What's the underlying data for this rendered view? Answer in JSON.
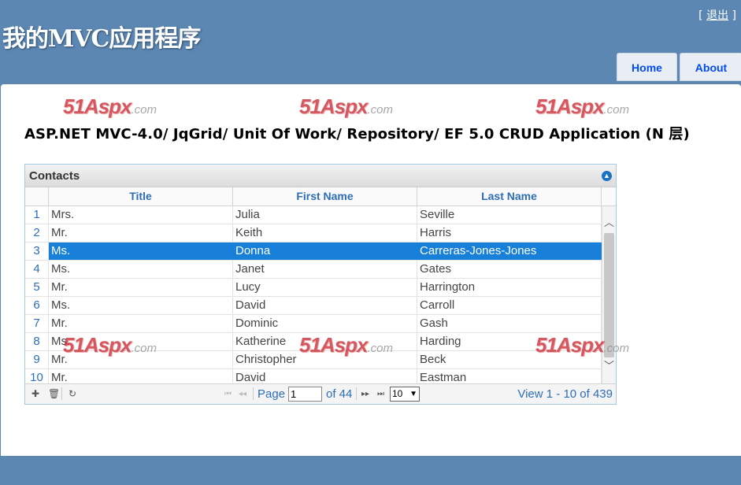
{
  "header": {
    "site_title": "我的MVC应用程序",
    "login_open": "[ ",
    "login_link": "退出",
    "login_close": " ]"
  },
  "menu": [
    {
      "label": "Home"
    },
    {
      "label": "About"
    }
  ],
  "watermark": {
    "brand": "51Aspx",
    "domain": ".com"
  },
  "page_heading": "ASP.NET MVC-4.0/ JqGrid/ Unit Of Work/ Repository/ EF 5.0 CRUD Application (N 层)",
  "grid": {
    "caption": "Contacts",
    "columns": [
      "Title",
      "First Name",
      "Last Name"
    ],
    "rows": [
      {
        "n": "1",
        "title": "Mrs.",
        "first": "Julia",
        "last": "Seville"
      },
      {
        "n": "2",
        "title": "Mr.",
        "first": "Keith",
        "last": "Harris"
      },
      {
        "n": "3",
        "title": "Ms.",
        "first": "Donna",
        "last": "Carreras-Jones-Jones"
      },
      {
        "n": "4",
        "title": "Ms.",
        "first": "Janet",
        "last": "Gates"
      },
      {
        "n": "5",
        "title": "Mr.",
        "first": "Lucy",
        "last": "Harrington"
      },
      {
        "n": "6",
        "title": "Ms.",
        "first": "David",
        "last": "Carroll"
      },
      {
        "n": "7",
        "title": "Mr.",
        "first": "Dominic",
        "last": "Gash"
      },
      {
        "n": "8",
        "title": "Ms.",
        "first": "Katherine",
        "last": "Harding"
      },
      {
        "n": "9",
        "title": "Mr.",
        "first": "Christopher",
        "last": "Beck"
      },
      {
        "n": "10",
        "title": "Mr.",
        "first": "David",
        "last": "Eastman"
      }
    ],
    "selected_row": "3",
    "pager": {
      "page_label": "Page",
      "page_value": "1",
      "of_label": "of 44",
      "rows_per_page": "10",
      "view_text": "View 1 - 10 of 439"
    }
  },
  "colors": {
    "background": "#5c87b2",
    "selection": "#1880d8",
    "link": "#2e6eb6"
  }
}
